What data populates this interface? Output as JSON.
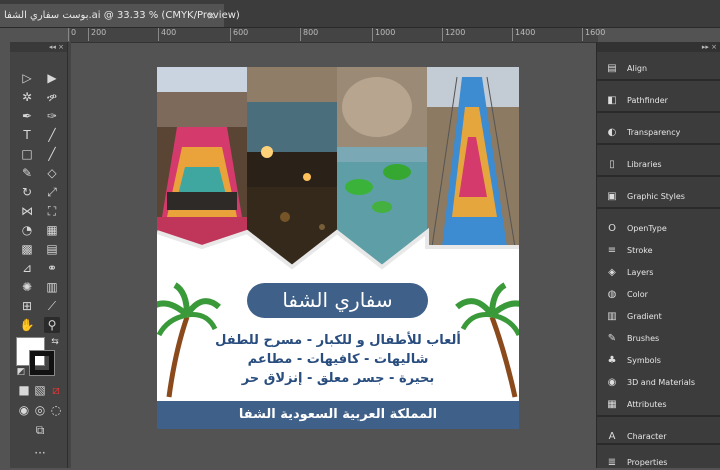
{
  "document_tab": {
    "title": "بوست سفاري الشفا.ai @ 33.33 % (CMYK/Preview)",
    "close": "×"
  },
  "ruler": {
    "ticks": [
      "0",
      "200",
      "400",
      "600",
      "800",
      "1000",
      "1200",
      "1400",
      "1600"
    ]
  },
  "toolbar": {
    "collapse": "◂◂ ×"
  },
  "panels": {
    "collapse": "▸▸ ×",
    "items": [
      {
        "label": "Align",
        "icon": "align-icon",
        "glyph": "▤"
      },
      {
        "label": "Pathfinder",
        "icon": "pathfinder-icon",
        "glyph": "◧"
      },
      {
        "label": "Transparency",
        "icon": "transparency-icon",
        "glyph": "◐"
      },
      {
        "label": "Libraries",
        "icon": "libraries-icon",
        "glyph": "▯"
      },
      {
        "label": "Graphic Styles",
        "icon": "graphic-styles-icon",
        "glyph": "▣"
      },
      {
        "label": "OpenType",
        "icon": "opentype-icon",
        "glyph": "O"
      },
      {
        "label": "Stroke",
        "icon": "stroke-icon",
        "glyph": "≡"
      },
      {
        "label": "Layers",
        "icon": "layers-icon",
        "glyph": "◈"
      },
      {
        "label": "Color",
        "icon": "color-icon",
        "glyph": "◍"
      },
      {
        "label": "Gradient",
        "icon": "gradient-icon",
        "glyph": "▥"
      },
      {
        "label": "Brushes",
        "icon": "brushes-icon",
        "glyph": "✎"
      },
      {
        "label": "Symbols",
        "icon": "symbols-icon",
        "glyph": "♣"
      },
      {
        "label": "3D and Materials",
        "icon": "3d-materials-icon",
        "glyph": "◉"
      },
      {
        "label": "Attributes",
        "icon": "attributes-icon",
        "glyph": "▦"
      },
      {
        "label": "Character",
        "icon": "character-icon",
        "glyph": "A"
      },
      {
        "label": "Properties",
        "icon": "properties-icon",
        "glyph": "≣"
      }
    ]
  },
  "poster": {
    "title": "سفاري الشفا",
    "lines": [
      "ألعاب للأطفال و للكبار - مسرح للطفل",
      "شاليهات - كافيهات - مطاعم",
      "بحيرة - جسر معلق - إنزلاق حر"
    ],
    "footer": "المملكة العربية السعودية   الشفا",
    "colors": {
      "brand_blue": "#3f6088",
      "text_blue": "#284d7e",
      "palm_green": "#3a9a3a",
      "trunk_brown": "#8b4a1c"
    }
  }
}
